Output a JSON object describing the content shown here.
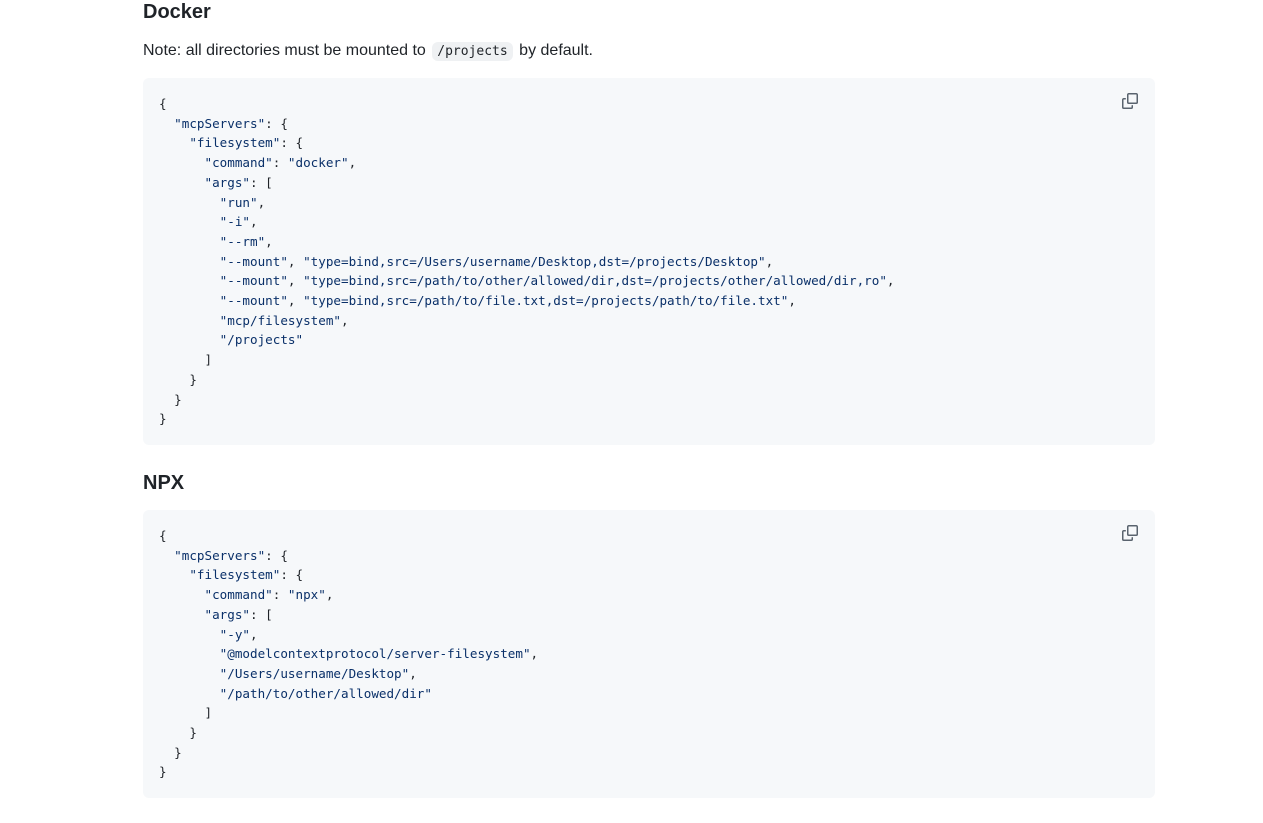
{
  "sections": {
    "docker": {
      "title": "Docker",
      "note_prefix": "Note: all directories must be mounted to",
      "note_code": "/projects",
      "note_suffix": "by default.",
      "code_lines": [
        "{",
        "  \"mcpServers\": {",
        "    \"filesystem\": {",
        "      \"command\": \"docker\",",
        "      \"args\": [",
        "        \"run\",",
        "        \"-i\",",
        "        \"--rm\",",
        "        \"--mount\", \"type=bind,src=/Users/username/Desktop,dst=/projects/Desktop\",",
        "        \"--mount\", \"type=bind,src=/path/to/other/allowed/dir,dst=/projects/other/allowed/dir,ro\",",
        "        \"--mount\", \"type=bind,src=/path/to/file.txt,dst=/projects/path/to/file.txt\",",
        "        \"mcp/filesystem\",",
        "        \"/projects\"",
        "      ]",
        "    }",
        "  }",
        "}"
      ]
    },
    "npx": {
      "title": "NPX",
      "code_lines": [
        "{",
        "  \"mcpServers\": {",
        "    \"filesystem\": {",
        "      \"command\": \"npx\",",
        "      \"args\": [",
        "        \"-y\",",
        "        \"@modelcontextprotocol/server-filesystem\",",
        "        \"/Users/username/Desktop\",",
        "        \"/path/to/other/allowed/dir\"",
        "      ]",
        "    }",
        "  }",
        "}"
      ]
    }
  },
  "icons": {
    "copy": "copy-icon"
  },
  "colors": {
    "code_bg": "#f6f8fa",
    "text": "#1f2328",
    "string": "#0a3069",
    "icon": "#59636e"
  }
}
